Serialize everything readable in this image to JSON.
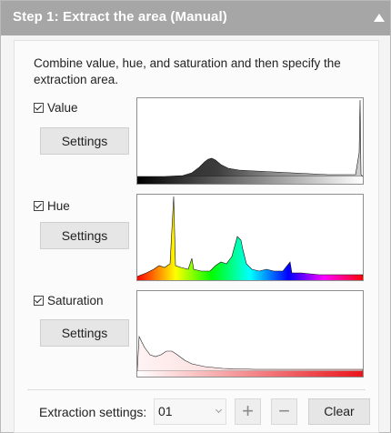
{
  "header": {
    "title": "Step 1: Extract the area (Manual)",
    "collapse_icon": "triangle-up-icon"
  },
  "description": "Combine value, hue, and saturation and then specify the extraction area.",
  "channels": [
    {
      "id": "value",
      "label": "Value",
      "checked": true,
      "button": "Settings"
    },
    {
      "id": "hue",
      "label": "Hue",
      "checked": true,
      "button": "Settings"
    },
    {
      "id": "saturation",
      "label": "Saturation",
      "checked": true,
      "button": "Settings"
    }
  ],
  "footer": {
    "label": "Extraction settings:",
    "selected": "01",
    "add": "+",
    "remove": "−",
    "clear": "Clear"
  },
  "colors": {
    "header_bg": "#a6a6a6",
    "value_fill": "#555555",
    "saturation_fill": "#f4b9b9",
    "saturation_ramp_end": "#e8151b"
  }
}
